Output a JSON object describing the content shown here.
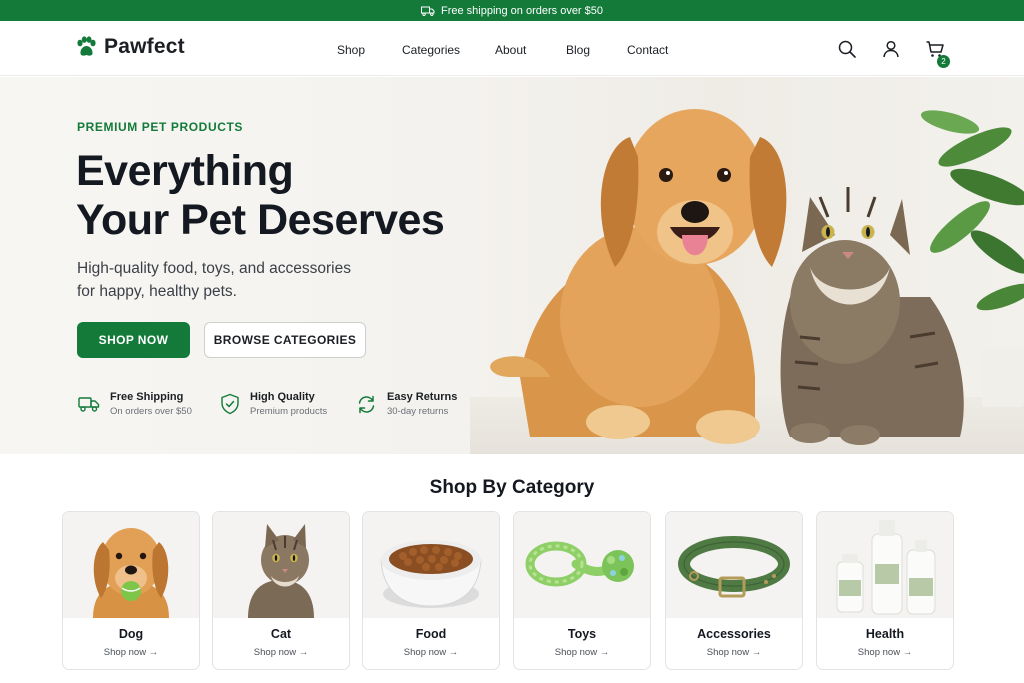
{
  "announcement": {
    "text": "Free shipping on orders over $50"
  },
  "header": {
    "brand": "Pawfect",
    "nav": [
      "Shop",
      "Categories",
      "About",
      "Blog",
      "Contact"
    ],
    "cart_count": "2"
  },
  "hero": {
    "eyebrow": "PREMIUM PET PRODUCTS",
    "headline_line1": "Everything",
    "headline_line2": "Your Pet Deserves",
    "sub_line1": "High-quality food, toys, and accessories",
    "sub_line2": "for happy, healthy pets.",
    "primary_cta": "SHOP NOW",
    "secondary_cta": "BROWSE CATEGORIES",
    "features": [
      {
        "title": "Free Shipping",
        "subtitle": "On orders over $50",
        "icon": "truck-icon"
      },
      {
        "title": "High Quality",
        "subtitle": "Premium products",
        "icon": "shield-check-icon"
      },
      {
        "title": "Easy Returns",
        "subtitle": "30-day returns",
        "icon": "refresh-icon"
      }
    ]
  },
  "categories": {
    "title": "Shop By Category",
    "items": [
      {
        "label": "Dog",
        "link": "Shop now"
      },
      {
        "label": "Cat",
        "link": "Shop now"
      },
      {
        "label": "Food",
        "link": "Shop now"
      },
      {
        "label": "Toys",
        "link": "Shop now"
      },
      {
        "label": "Accessories",
        "link": "Shop now"
      },
      {
        "label": "Health",
        "link": "Shop now"
      }
    ]
  },
  "colors": {
    "brand_green": "#137a3a",
    "text_dark": "#141820"
  }
}
